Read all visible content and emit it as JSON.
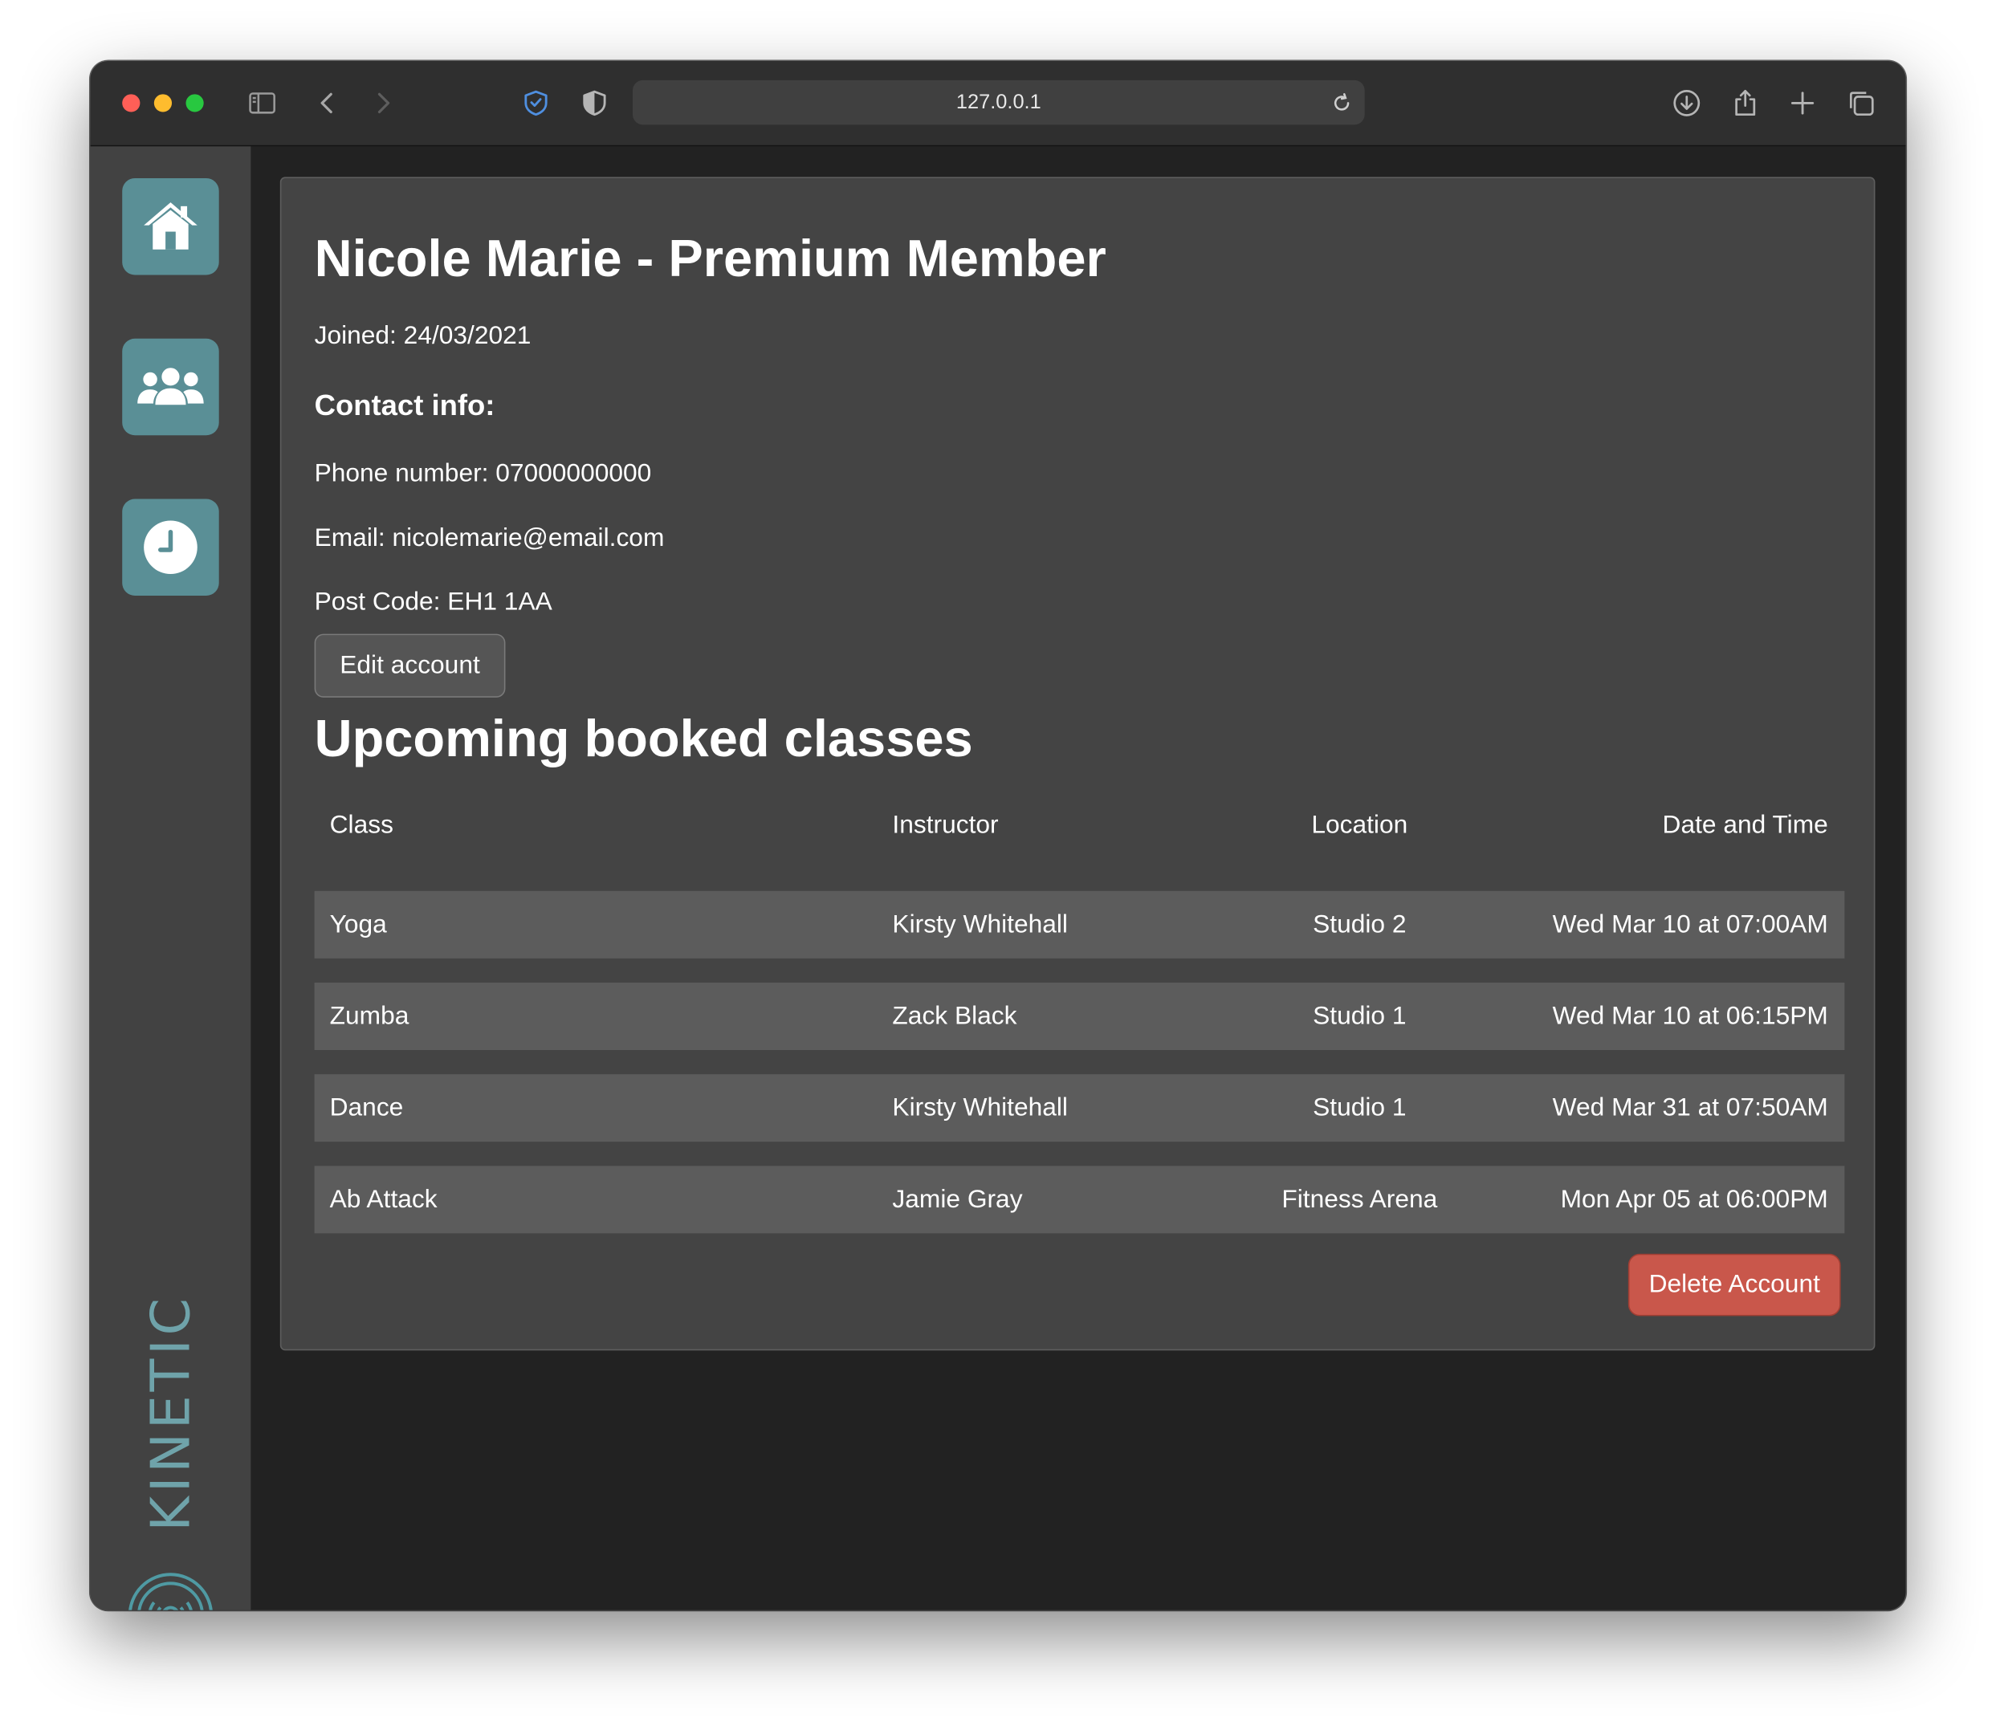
{
  "browser": {
    "url": "127.0.0.1"
  },
  "sidebar": {
    "items": [
      {
        "label": "Home",
        "icon": "home-icon"
      },
      {
        "label": "Members",
        "icon": "users-icon"
      },
      {
        "label": "Schedule",
        "icon": "clock-icon"
      }
    ],
    "brand": "KINETIC",
    "brand_logo_icon": "kinetic-logo-icon"
  },
  "profile": {
    "title": "Nicole Marie - Premium Member",
    "joined": "Joined: 24/03/2021",
    "contact_heading": "Contact info:",
    "phone": "Phone number: 07000000000",
    "email": "Email: nicolemarie@email.com",
    "postcode": "Post Code: EH1 1AA",
    "edit_label": "Edit account"
  },
  "classes": {
    "title": "Upcoming booked classes",
    "headers": [
      "Class",
      "Instructor",
      "Location",
      "Date and Time"
    ],
    "rows": [
      [
        "Yoga",
        "Kirsty Whitehall",
        "Studio 2",
        "Wed Mar 10 at 07:00AM"
      ],
      [
        "Zumba",
        "Zack Black",
        "Studio 1",
        "Wed Mar 10 at 06:15PM"
      ],
      [
        "Dance",
        "Kirsty Whitehall",
        "Studio 1",
        "Wed Mar 31 at 07:50AM"
      ],
      [
        "Ab Attack",
        "Jamie Gray",
        "Fitness Arena",
        "Mon Apr 05 at 06:00PM"
      ]
    ]
  },
  "delete_label": "Delete Account",
  "colors": {
    "accent": "#5a8f96",
    "danger": "#c9574b",
    "card": "#444444",
    "sidebar": "#424242",
    "background": "#222222"
  }
}
